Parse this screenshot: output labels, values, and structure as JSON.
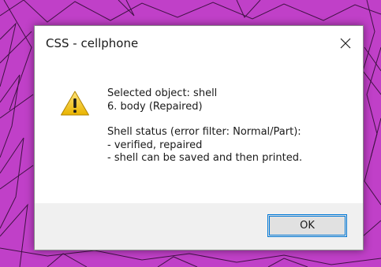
{
  "dialog": {
    "title": "CSS - cellphone",
    "close_icon": "close-icon",
    "warning_icon": "warning-icon",
    "message": {
      "line1": "Selected object: shell",
      "line2": "6. body (Repaired)",
      "line3": "Shell status (error filter: Normal/Part):",
      "line4": "- verified, repaired",
      "line5": "- shell can be saved and then printed."
    },
    "ok_label": "OK"
  },
  "colors": {
    "backdrop": "#c040c8",
    "mesh_lines": "#2a0a2e",
    "accent": "#0078d7",
    "warning_yellow": "#f2c811"
  }
}
